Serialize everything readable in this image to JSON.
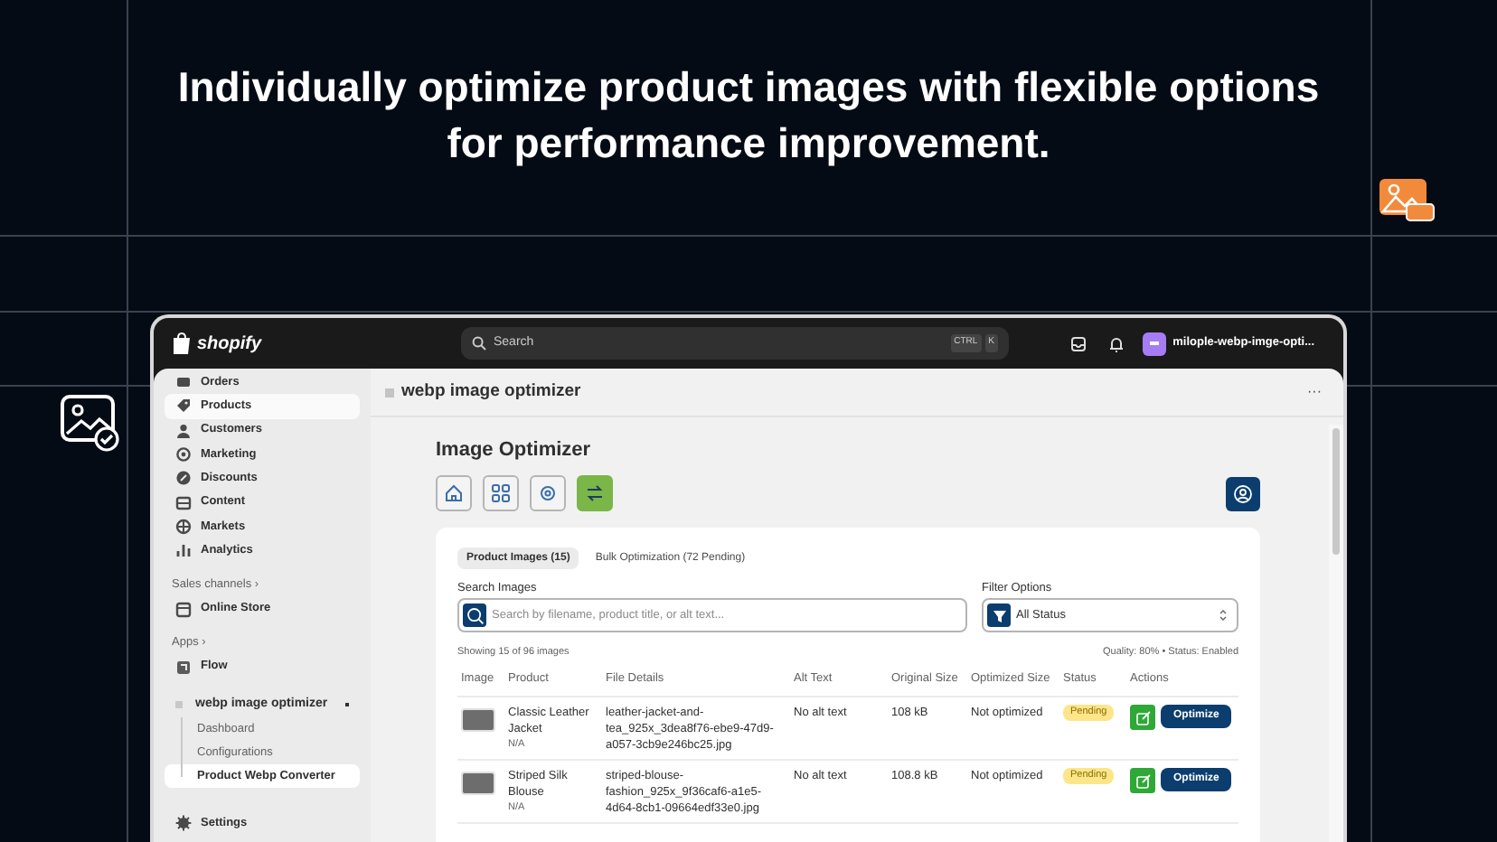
{
  "headline": "Individually optimize product images with flexible options for performance improvement.",
  "topbar": {
    "logo": "shopify",
    "search": {
      "placeholder": "Search"
    },
    "shortcut": [
      "CTRL",
      "K"
    ],
    "store": "milople-webp-imge-opti..."
  },
  "sidebar": {
    "items": [
      {
        "kind": "item",
        "label": "Orders",
        "selected": false
      },
      {
        "kind": "item",
        "label": "Products",
        "selected": true
      },
      {
        "kind": "item",
        "label": "Customers",
        "selected": false
      },
      {
        "kind": "item",
        "label": "Marketing",
        "selected": false
      },
      {
        "kind": "item",
        "label": "Discounts",
        "selected": false
      },
      {
        "kind": "item",
        "label": "Content",
        "selected": false
      },
      {
        "kind": "item",
        "label": "Markets",
        "selected": false
      },
      {
        "kind": "item",
        "label": "Analytics",
        "selected": false
      },
      {
        "kind": "heading",
        "label": "Sales channels ›"
      },
      {
        "kind": "item",
        "label": "Online Store",
        "selected": false
      },
      {
        "kind": "heading",
        "label": "Apps ›"
      },
      {
        "kind": "item",
        "label": "Flow",
        "selected": false
      },
      {
        "kind": "app",
        "label": "webp image optimizer",
        "children": [
          {
            "label": "Dashboard",
            "selected": false
          },
          {
            "label": "Configurations",
            "selected": false
          },
          {
            "label": "Product Webp Converter",
            "selected": true
          }
        ]
      },
      {
        "kind": "settings",
        "label": "Settings",
        "selected": false
      }
    ]
  },
  "page_header": {
    "title": "webp image optimizer",
    "more": "···"
  },
  "app": {
    "title": "Image Optimizer",
    "toolbar": [
      {
        "selected": false
      },
      {
        "selected": false
      },
      {
        "selected": false
      },
      {
        "selected": true
      }
    ],
    "tabs": [
      {
        "label": "Product Images (15)",
        "selected": true
      },
      {
        "label": "Bulk Optimization (72 Pending)",
        "selected": false
      }
    ],
    "search": {
      "label": "Search Images",
      "placeholder": "Search by filename, product title, or alt text..."
    },
    "filter": {
      "label": "Filter Options",
      "value": "All Status"
    },
    "showing": "Showing 15 of 96 images",
    "settings_note": "Quality: 80% • Status: Enabled",
    "table": {
      "columns": [
        "Image",
        "Product",
        "File Details",
        "Alt Text",
        "Original Size",
        "Optimized Size",
        "Status",
        "Actions"
      ],
      "rows": [
        {
          "product": "Classic Leather Jacket",
          "sub": "N/A",
          "file": "leather-jacket-and-tea_925x_3dea8f76-ebe9-47d9-a057-3cb9e246bc25.jpg",
          "alt": "No alt text",
          "original": "108 kB",
          "optimized": "Not optimized",
          "status": "Pending",
          "action": "Optimize"
        },
        {
          "product": "Striped Silk Blouse",
          "sub": "N/A",
          "file": "striped-blouse-fashion_925x_9f36caf6-a1e5-4d64-8cb1-09664edf33e0.jpg",
          "alt": "No alt text",
          "original": "108.8 kB",
          "optimized": "Not optimized",
          "status": "Pending",
          "action": "Optimize"
        }
      ]
    }
  }
}
